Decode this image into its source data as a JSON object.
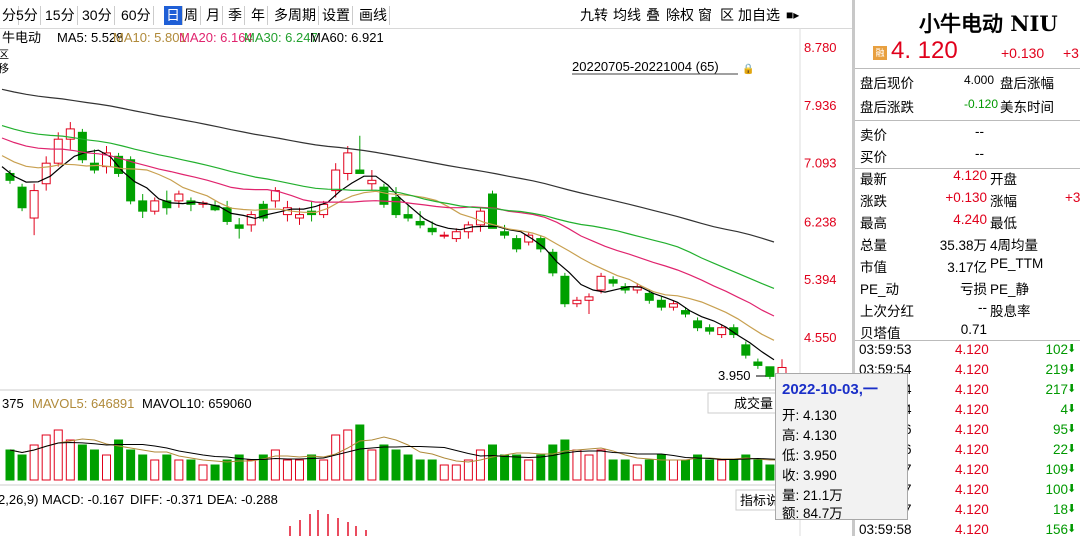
{
  "toolbar": {
    "periods": [
      "分",
      "5分",
      "15分",
      "30分",
      "60分",
      "日",
      "周",
      "月",
      "季",
      "年",
      "多周期",
      "设置",
      "画线"
    ],
    "active": "日",
    "right_items": [
      "九转",
      "均线",
      "叠",
      "除权",
      "窗",
      "区",
      "加自选"
    ]
  },
  "chart": {
    "ma_legend": {
      "prefix": "牛电动",
      "ma5": "MA5: 5.528",
      "ma10": "MA10: 5.801",
      "ma20": "MA20: 6.164",
      "ma30": "MA30: 6.247",
      "ma60": "MA60: 6.921"
    },
    "left_marks": [
      "区",
      "移"
    ],
    "range_label": "20220705-20221004 (65)",
    "price_axis": [
      "8.780",
      "7.936",
      "7.093",
      "6.238",
      "5.394",
      "4.550"
    ],
    "low_label": "3.950",
    "vol_legend": {
      "prefix": "375",
      "mavol5": "MAVOL5: 646891",
      "mavol10": "MAVOL10: 659060"
    },
    "vol_button": "成交量",
    "macd_legend": {
      "prefix": "2,26,9)",
      "macd": "MACD: -0.167",
      "diff": "DIFF: -0.371",
      "dea": "DEA: -0.288"
    },
    "macd_button": "指标说",
    "colors": {
      "up": "#e0001b",
      "down": "#00a000",
      "ma5": "#000000",
      "ma10": "#c8a050",
      "ma20": "#e0246e",
      "ma30": "#22b02e",
      "ma60": "#333333"
    }
  },
  "tooltip": {
    "date": "2022-10-03,一",
    "open": "开: 4.130",
    "high": "高: 4.130",
    "low": "低: 3.950",
    "close": "收: 3.990",
    "vol": "量: 21.1万",
    "amt": "额: 84.7万"
  },
  "panel": {
    "title": "小牛电动 NIU",
    "badge": "融",
    "price": "4. 120",
    "change": "+0.130",
    "change_pct": "+3",
    "after": [
      {
        "label": "盘后现价",
        "value": "4.000",
        "label2": "盘后涨幅"
      },
      {
        "label": "盘后涨跌",
        "value": "-0.120",
        "label2": "美东时间"
      }
    ],
    "book": [
      {
        "label": "卖价",
        "value": "--"
      },
      {
        "label": "买价",
        "value": "--"
      }
    ],
    "stats": [
      {
        "l": "最新",
        "v": "4.120",
        "l2": "开盘",
        "vc": "red"
      },
      {
        "l": "涨跌",
        "v": "+0.130",
        "l2": "涨幅",
        "v2": "+3",
        "vc": "red"
      },
      {
        "l": "最高",
        "v": "4.240",
        "l2": "最低",
        "vc": "red"
      },
      {
        "l": "总量",
        "v": "35.38万",
        "l2": "4周均量",
        "vc": "black"
      },
      {
        "l": "市值",
        "v": "3.17亿",
        "l2": "PE_TTM",
        "vc": "black"
      },
      {
        "l": "PE_动",
        "v": "亏损",
        "l2": "PE_静",
        "vc": "black"
      },
      {
        "l": "上次分红",
        "v": "--",
        "l2": "股息率",
        "vc": "black"
      },
      {
        "l": "贝塔值",
        "v": "0.71",
        "l2": "",
        "vc": "black"
      }
    ],
    "ticks": [
      {
        "t": "03:59:53",
        "p": "4.120",
        "v": "102"
      },
      {
        "t": "03:59:54",
        "p": "4.120",
        "v": "219"
      },
      {
        "t": "03:59:54",
        "p": "4.120",
        "v": "217"
      },
      {
        "t": "03:59:54",
        "p": "4.120",
        "v": "4"
      },
      {
        "t": "03:59:56",
        "p": "4.120",
        "v": "95"
      },
      {
        "t": "03:59:56",
        "p": "4.120",
        "v": "22"
      },
      {
        "t": "03:59:57",
        "p": "4.120",
        "v": "109"
      },
      {
        "t": "03:59:57",
        "p": "4.120",
        "v": "100"
      },
      {
        "t": "03:59:57",
        "p": "4.120",
        "v": "18"
      },
      {
        "t": "03:59:58",
        "p": "4.120",
        "v": "156"
      }
    ]
  }
}
